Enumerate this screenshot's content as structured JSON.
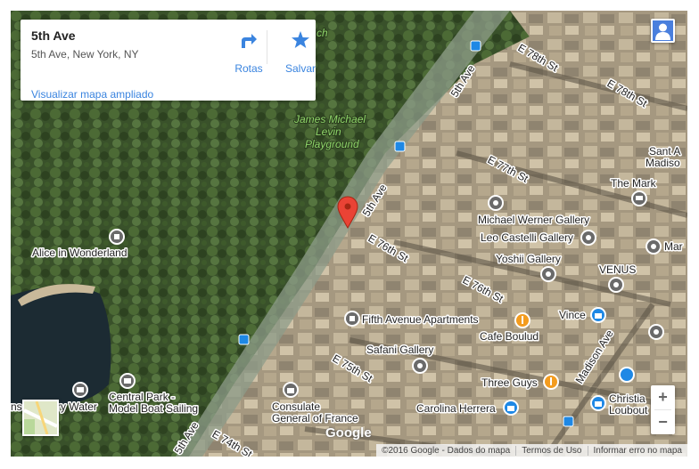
{
  "place_card": {
    "title": "5th Ave",
    "address": "5th Ave, New York, NY",
    "directions_label": "Rotas",
    "save_label": "Salvar",
    "view_larger_link": "Visualizar mapa ampliado"
  },
  "map_labels": {
    "street_e78": "E 78th St",
    "street_e78b": "E 78th St",
    "street_e77": "E 77th St",
    "street_e76": "E 76th St",
    "street_e76b": "E 76th St",
    "street_e75": "E 75th St",
    "street_e74": "E 74th St",
    "fifth_ave_1": "5th Ave",
    "fifth_ave_2": "5th Ave",
    "fifth_ave_3": "5th Ave",
    "madison_ave": "Madison Ave",
    "james_michael_1": "James Michael",
    "james_michael_2": "Levin",
    "james_michael_3": "Playground",
    "ch_fragment": "ch",
    "alice": "Alice in Wonderland",
    "michael_werner": "Michael Werner Gallery",
    "leo_castelli": "Leo Castelli Gallery",
    "yoshii": "Yoshii Gallery",
    "venus": "VENUS",
    "the_mark": "The Mark",
    "sant_a": "Sant A",
    "madiso": "Madiso",
    "mar": "Mar",
    "fifth_ave_apts": "Fifth Avenue Apartments",
    "vince": "Vince",
    "cafe_boulud": "Cafe Boulud",
    "safani": "Safani Gallery",
    "three_guys": "Three Guys",
    "central_park_1": "Central Park -",
    "central_park_2": "Model Boat Sailing",
    "consulate_1": "Consulate",
    "consulate_2": "General of France",
    "carolina": "Carolina Herrera",
    "christian_1": "Christia",
    "christian_2": "Loubout",
    "ry_water": "ry Water",
    "ns": "ns"
  },
  "zoom_in_label": "+",
  "zoom_out_label": "−",
  "google_logo": "Google",
  "footer": {
    "copyright": "©2016 Google - Dados do mapa",
    "terms": "Termos de Uso",
    "report": "Informar erro no mapa"
  },
  "colors": {
    "accent": "#3a84df",
    "pin": "#ea4335",
    "poi_gray": "#6a6a6a",
    "poi_orange": "#f39c1f",
    "transit_blue": "#1e88e5"
  },
  "icons": {
    "directions": "directions-arrow-icon",
    "save": "star-icon",
    "avatar": "person-icon",
    "pin": "map-pin-icon"
  }
}
